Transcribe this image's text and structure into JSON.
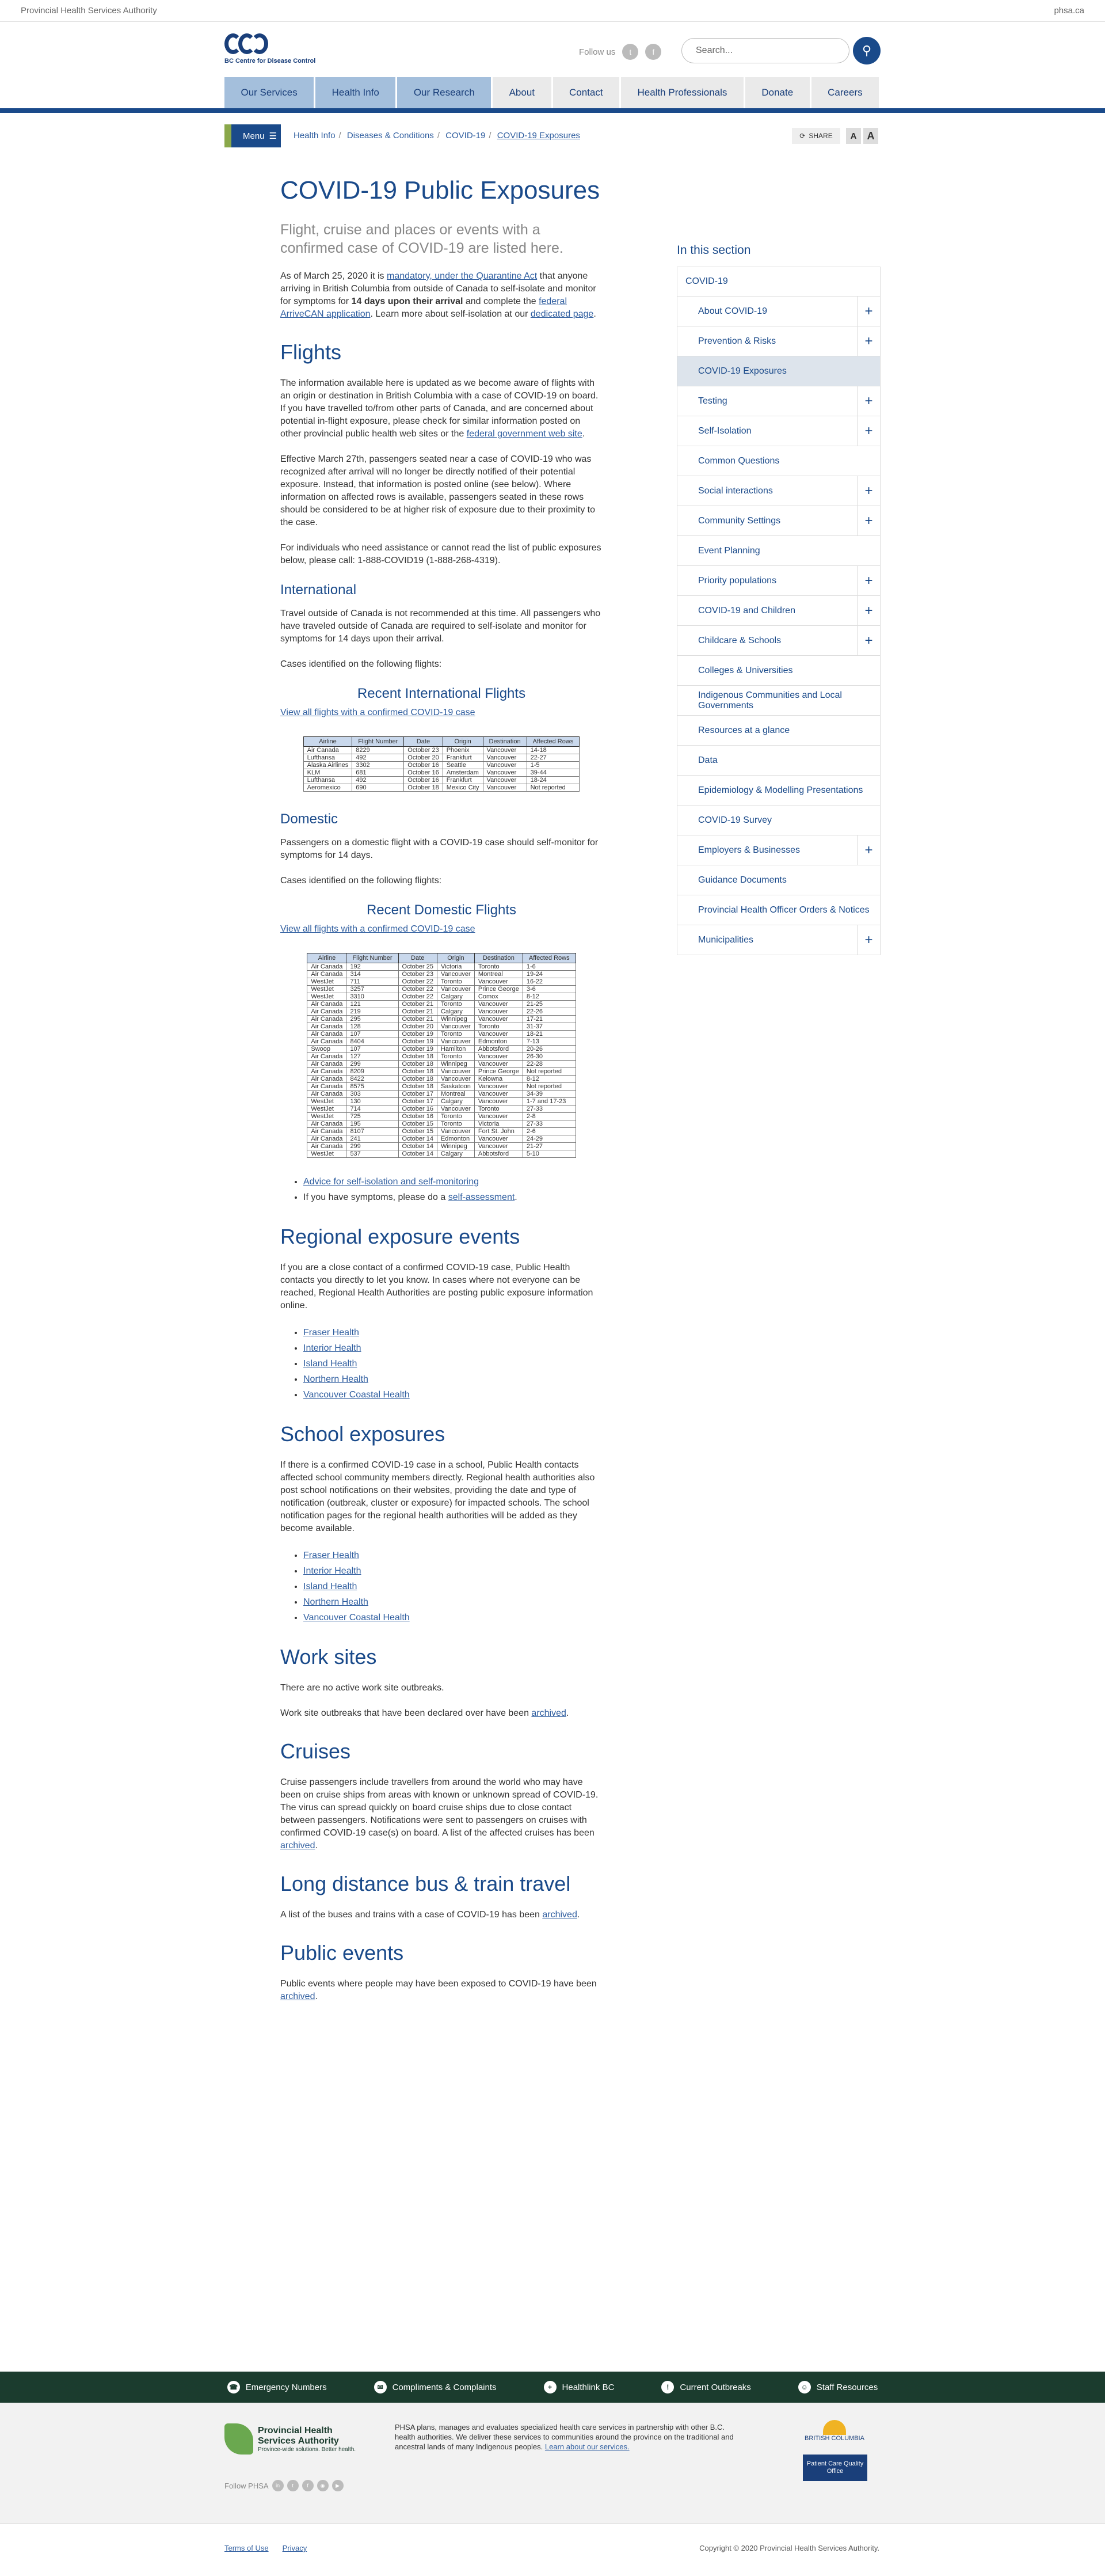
{
  "topbar": {
    "left": "Provincial Health Services Authority",
    "right": "phsa.ca"
  },
  "header": {
    "logo_text": "BC Centre for Disease Control",
    "follow": "Follow us",
    "search_placeholder": "Search..."
  },
  "nav": [
    "Our Services",
    "Health Info",
    "Our Research",
    "About",
    "Contact",
    "Health Professionals",
    "Donate",
    "Careers"
  ],
  "menu": "Menu",
  "breadcrumbs": [
    "Health Info",
    "Diseases & Conditions",
    "COVID-19",
    "COVID-19 Exposures"
  ],
  "share": "SHARE",
  "page": {
    "title": "COVID-19 Public Exposures",
    "subtitle": "Flight, cruise and places or events with a confirmed case of COVID-19 are listed here.",
    "intro": {
      "a": "As of March 25, 2020 it is ",
      "link1": "mandatory, under the Quarantine Act",
      "b": " that anyone arriving in British Columbia from outside of Canada to self-isolate and monitor for symptoms for ",
      "bold": "14 days upon their arrival",
      "c": " and complete the ",
      "link2": "federal ArriveCAN application",
      "d": ". Learn more about self-isolation at our ",
      "link3": "dedicated page",
      "e": "."
    },
    "flights_h": "Flights",
    "flights_p1a": "The information available here is updated as we become aware of flights with an origin or destination in British Columbia with a case of COVID-19 on board. If you have travelled to/from other parts of Canada, and are concerned about potential in-flight exposure, please check for similar information posted on other provincial public health web sites or the ",
    "flights_p1link": "federal government web site",
    "flights_p1b": ".",
    "flights_p2": "Effective March 27th, passengers seated near a case of COVID-19 who was recognized after arrival will no longer be directly notified of their potential exposure. Instead, that information is posted online (see below). Where information on affected rows is available, passengers seated in these rows should be considered to be at higher risk of exposure due to their proximity to the case.",
    "flights_p3": "For individuals who need assistance or cannot read the list of public exposures below, please call: 1-888-COVID19 (1-888-268-4319).",
    "intl_h": "International",
    "intl_p1": "Travel outside of Canada is not recommended at this time. All passengers who have traveled outside of Canada are required to self-isolate and monitor for symptoms for 14 days upon their arrival.",
    "intl_p2": "Cases identified on the following flights:",
    "intl_table_h": "Recent International Flights",
    "intl_link": "View all flights with a confirmed COVID-19 case",
    "dom_h": "Domestic",
    "dom_p1": "Passengers on a domestic flight with a COVID-19 case should self-monitor for symptoms for 14 days.",
    "dom_p2": "Cases identified on the following flights:",
    "dom_table_h": "Recent Domestic Flights",
    "dom_link": "View all flights with a confirmed COVID-19 case",
    "advice_link": "Advice for self-isolation and self-monitoring",
    "symptoms_a": "If you have symptoms, please do a ",
    "symptoms_link": "self-assessment",
    "symptoms_b": ".",
    "regional_h": "Regional exposure events",
    "regional_p": "If you are a close contact of a confirmed COVID-19 case, Public Health contacts you directly to let you know. In cases where not everyone can be reached, Regional Health Authorities are posting public exposure information online.",
    "authorities": [
      "Fraser Health",
      "Interior Health ",
      "Island Health",
      "Northern Health",
      "Vancouver Coastal Health"
    ],
    "school_h": "School exposures",
    "school_p": "If there is a confirmed COVID-19 case in a school, Public Health contacts affected school community members directly. Regional health authorities also post school notifications on their websites, providing the date and type of notification (outbreak, cluster or exposure) for impacted schools. The school notification pages for the regional health authorities will be added as they become available.",
    "work_h": "Work sites",
    "work_p1": "There are no active work site outbreaks.",
    "work_p2a": "Work site outbreaks that have been declared over have been ",
    "archived": "archived",
    "cruise_h": "Cruises",
    "cruise_p": "Cruise passengers include travellers from around the world who may have been on cruise ships from areas with known or unknown spread of COVID-19. The virus can spread quickly on board cruise ships due to close contact between passengers. Notifications were sent to passengers on cruises with confirmed COVID-19 case(s) on board. A list of the affected cruises has been ",
    "bus_h": "Long distance bus & train travel",
    "bus_p": "A list of the buses and trains with a case of COVID-19 has been ",
    "events_h": "Public events",
    "events_p": "Public events where people may have been exposed to COVID-19 have been ",
    "dot": "."
  },
  "table_headers": [
    "Airline",
    "Flight Number",
    "Date",
    "Origin",
    "Destination",
    "Affected Rows"
  ],
  "intl_flights": [
    [
      "Air Canada",
      "8229",
      "October 23",
      "Phoenix",
      "Vancouver",
      "14-18"
    ],
    [
      "Lufthansa",
      "492",
      "October 20",
      "Frankfurt",
      "Vancouver",
      "22-27"
    ],
    [
      "Alaska Airlines",
      "3302",
      "October 16",
      "Seattle",
      "Vancouver",
      "1-5"
    ],
    [
      "KLM",
      "681",
      "October 16",
      "Amsterdam",
      "Vancouver",
      "39-44"
    ],
    [
      "Lufthansa",
      "492",
      "October 16",
      "Frankfurt",
      "Vancouver",
      "18-24"
    ],
    [
      "Aeromexico",
      "690",
      "October 18",
      "Mexico City",
      "Vancouver",
      "Not reported"
    ]
  ],
  "dom_flights": [
    [
      "Air Canada",
      "192",
      "October 25",
      "Victoria",
      "Toronto",
      "1-6"
    ],
    [
      "Air Canada",
      "314",
      "October 23",
      "Vancouver",
      "Montreal",
      "19-24"
    ],
    [
      "WestJet",
      "711",
      "October 22",
      "Toronto",
      "Vancouver",
      "16-22"
    ],
    [
      "WestJet",
      "3257",
      "October 22",
      "Vancouver",
      "Prince George",
      "3-6"
    ],
    [
      "WestJet",
      "3310",
      "October 22",
      "Calgary",
      "Comox",
      "8-12"
    ],
    [
      "Air Canada",
      "121",
      "October 21",
      "Toronto",
      "Vancouver",
      "21-25"
    ],
    [
      "Air Canada",
      "219",
      "October 21",
      "Calgary",
      "Vancouver",
      "22-26"
    ],
    [
      "Air Canada",
      "295",
      "October 21",
      "Winnipeg",
      "Vancouver",
      "17-21"
    ],
    [
      "Air Canada",
      "128",
      "October 20",
      "Vancouver",
      "Toronto",
      "31-37"
    ],
    [
      "Air Canada",
      "107",
      "October 19",
      "Toronto",
      "Vancouver",
      "18-21"
    ],
    [
      "Air Canada",
      "8404",
      "October 19",
      "Vancouver",
      "Edmonton",
      "7-13"
    ],
    [
      "Swoop",
      "107",
      "October 19",
      "Hamilton",
      "Abbotsford",
      "20-26"
    ],
    [
      "Air Canada",
      "127",
      "October 18",
      "Toronto",
      "Vancouver",
      "26-30"
    ],
    [
      "Air Canada",
      "299",
      "October 18",
      "Winnipeg",
      "Vancouver",
      "22-28"
    ],
    [
      "Air Canada",
      "8209",
      "October 18",
      "Vancouver",
      "Prince George",
      "Not reported"
    ],
    [
      "Air Canada",
      "8422",
      "October 18",
      "Vancouver",
      "Kelowna",
      "8-12"
    ],
    [
      "Air Canada",
      "8575",
      "October 18",
      "Saskatoon",
      "Vancouver",
      "Not reported"
    ],
    [
      "Air Canada",
      "303",
      "October 17",
      "Montreal",
      "Vancouver",
      "34-39"
    ],
    [
      "WestJet",
      "130",
      "October 17",
      "Calgary",
      "Vancouver",
      "1-7 and 17-23"
    ],
    [
      "WestJet",
      "714",
      "October 16",
      "Vancouver",
      "Toronto",
      "27-33"
    ],
    [
      "WestJet",
      "725",
      "October 16",
      "Toronto",
      "Vancouver",
      "2-8"
    ],
    [
      "Air Canada",
      "195",
      "October 15",
      "Toronto",
      "Victoria",
      "27-33"
    ],
    [
      "Air Canada",
      "8107",
      "October 15",
      "Vancouver",
      "Fort St. John",
      "2-6"
    ],
    [
      "Air Canada",
      "241",
      "October 14",
      "Edmonton",
      "Vancouver",
      "24-29"
    ],
    [
      "Air Canada",
      "299",
      "October 14",
      "Winnipeg",
      "Vancouver",
      "21-27"
    ],
    [
      "WestJet",
      "537",
      "October 14",
      "Calgary",
      "Abbotsford",
      "5-10"
    ]
  ],
  "sidebar": {
    "title": "In this section",
    "items": [
      {
        "label": "COVID-19",
        "plus": false
      },
      {
        "label": "About COVID-19",
        "plus": true
      },
      {
        "label": "Prevention & Risks",
        "plus": true
      },
      {
        "label": "COVID-19 Exposures",
        "plus": false,
        "active": true
      },
      {
        "label": "Testing",
        "plus": true
      },
      {
        "label": "Self-Isolation",
        "plus": true
      },
      {
        "label": "Common Questions",
        "plus": false
      },
      {
        "label": "Social interactions",
        "plus": true
      },
      {
        "label": "Community Settings",
        "plus": true
      },
      {
        "label": "Event Planning",
        "plus": false
      },
      {
        "label": "Priority populations",
        "plus": true
      },
      {
        "label": "COVID-19 and Children",
        "plus": true
      },
      {
        "label": "Childcare & Schools",
        "plus": true
      },
      {
        "label": "Colleges & Universities",
        "plus": false
      },
      {
        "label": "Indigenous Communities and Local Governments",
        "plus": false
      },
      {
        "label": "Resources at a glance",
        "plus": false
      },
      {
        "label": "Data",
        "plus": false
      },
      {
        "label": "Epidemiology & Modelling Presentations",
        "plus": false
      },
      {
        "label": "COVID-19 Survey",
        "plus": false
      },
      {
        "label": "Employers & Businesses",
        "plus": true
      },
      {
        "label": "Guidance Documents",
        "plus": false
      },
      {
        "label": "Provincial Health Officer Orders & Notices",
        "plus": false
      },
      {
        "label": "Municipalities",
        "plus": true
      }
    ]
  },
  "footer": {
    "links": [
      "Emergency Numbers",
      "Compliments & Complaints",
      "Healthlink BC",
      "Current Outbreaks",
      "Staff Resources"
    ],
    "phsa_name": "Provincial Health Services Authority",
    "phsa_tag": "Province-wide solutions. Better health.",
    "phsa_text": "PHSA plans, manages and evaluates specialized health care services in partnership with other B.C. health authorities. We deliver these services to communities around the province on the traditional and ancestral lands of many Indigenous peoples. ",
    "learn_more": "Learn about our services.",
    "bc": "BRITISH COLUMBIA",
    "pcqo": "Patient Care Quality Office",
    "follow_phsa": "Follow PHSA",
    "terms": "Terms of Use",
    "privacy": "Privacy",
    "copyright": "Copyright © 2020 Provincial Health Services Authority."
  }
}
